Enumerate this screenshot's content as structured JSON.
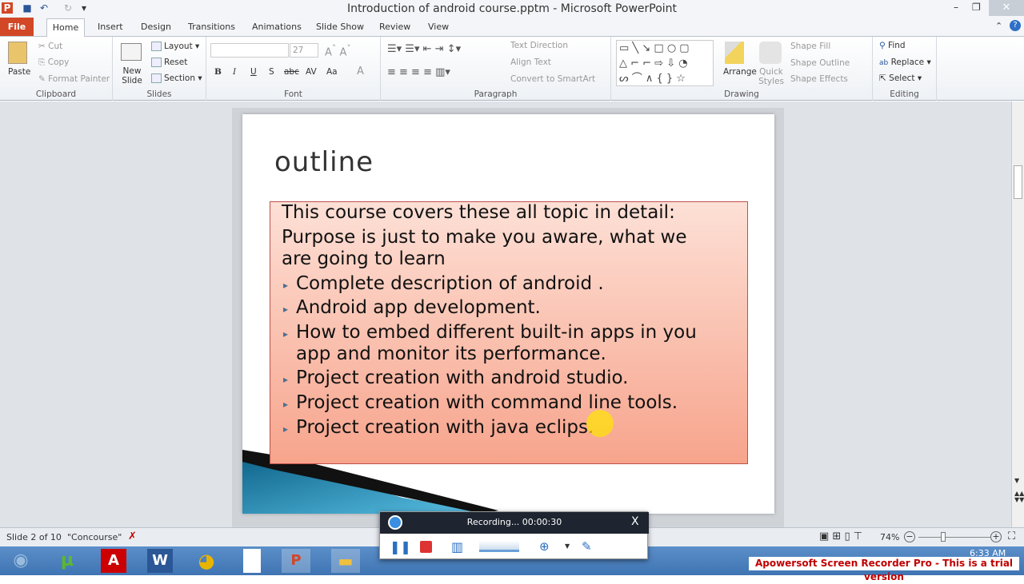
{
  "window": {
    "title": "Introduction of android course.pptm - Microsoft PowerPoint"
  },
  "tabs": [
    "File",
    "Home",
    "Insert",
    "Design",
    "Transitions",
    "Animations",
    "Slide Show",
    "Review",
    "View"
  ],
  "ribbon": {
    "clipboard": {
      "label": "Clipboard",
      "paste": "Paste",
      "cut": "Cut",
      "copy": "Copy",
      "format_painter": "Format Painter"
    },
    "slides": {
      "label": "Slides",
      "new_slide": "New Slide",
      "layout": "Layout",
      "reset": "Reset",
      "section": "Section"
    },
    "font": {
      "label": "Font",
      "size": "27",
      "bold": "B",
      "italic": "I",
      "underline": "U",
      "shadow": "S",
      "strike": "abc",
      "spacing": "AV",
      "case": "Aa",
      "color": "A"
    },
    "paragraph": {
      "label": "Paragraph",
      "text_direction": "Text Direction",
      "align_text": "Align Text",
      "smartart": "Convert to SmartArt"
    },
    "drawing": {
      "label": "Drawing",
      "arrange": "Arrange",
      "quick_styles": "Quick Styles",
      "shape_fill": "Shape Fill",
      "shape_outline": "Shape Outline",
      "shape_effects": "Shape Effects"
    },
    "editing": {
      "label": "Editing",
      "find": "Find",
      "replace": "Replace",
      "select": "Select"
    }
  },
  "slide": {
    "title": "outline",
    "lines": [
      "This course covers these all topic in detail:",
      "Purpose is just  to make you aware, what we",
      "are going to learn"
    ],
    "bullets": [
      "Complete description of android .",
      "Android app development.",
      "How to embed different built-in apps in you",
      "app and monitor its performance.",
      "Project creation with android studio.",
      "Project creation with command line tools.",
      "Project creation with java eclips."
    ]
  },
  "status": {
    "slide": "Slide 2 of 10",
    "theme": "\"Concourse\"",
    "zoom": "74%"
  },
  "recorder": {
    "status": "Recording... 00:00:30",
    "close": "X"
  },
  "taskbar": {
    "clock": "6:33 AM",
    "trial": "Apowersoft Screen Recorder Pro - This is a trial version"
  }
}
